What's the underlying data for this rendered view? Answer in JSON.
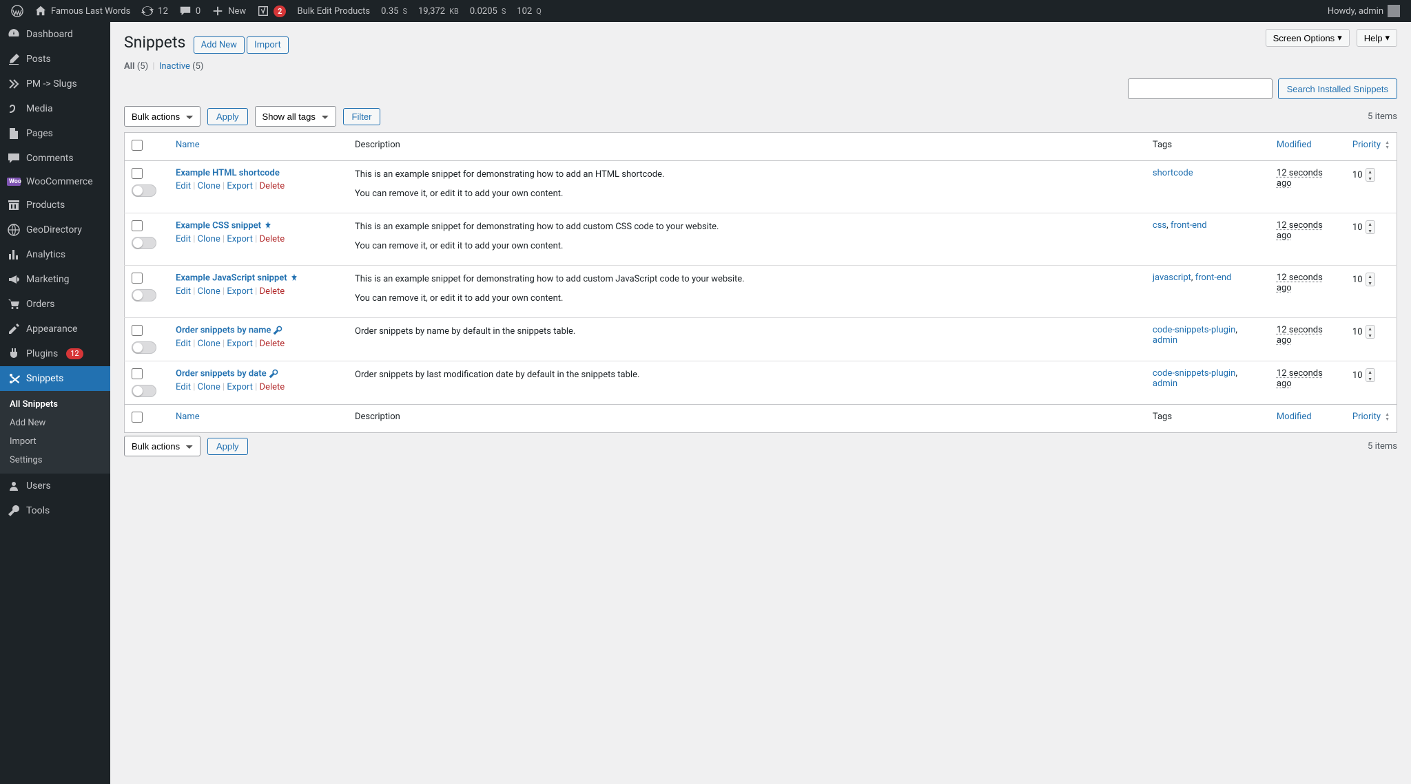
{
  "adminbar": {
    "site_name": "Famous Last Words",
    "updates": "12",
    "comments": "0",
    "new_label": "New",
    "yoast_count": "2",
    "bulk_edit": "Bulk Edit Products",
    "qm_time": "0.35",
    "qm_time_unit": "S",
    "qm_mem": "19,372",
    "qm_mem_unit": "KB",
    "qm_dbtime": "0.0205",
    "qm_dbtime_unit": "S",
    "qm_queries": "102",
    "qm_queries_unit": "Q",
    "howdy": "Howdy, admin"
  },
  "sidebar": {
    "dashboard": "Dashboard",
    "posts": "Posts",
    "pm_slugs": "PM -> Slugs",
    "media": "Media",
    "pages": "Pages",
    "comments": "Comments",
    "woocommerce": "WooCommerce",
    "products": "Products",
    "geodirectory": "GeoDirectory",
    "analytics": "Analytics",
    "marketing": "Marketing",
    "orders": "Orders",
    "appearance": "Appearance",
    "plugins": "Plugins",
    "plugins_count": "12",
    "snippets": "Snippets",
    "users": "Users",
    "tools": "Tools",
    "submenu": {
      "all": "All Snippets",
      "add": "Add New",
      "import": "Import",
      "settings": "Settings"
    }
  },
  "header": {
    "screen_options": "Screen Options",
    "help": "Help",
    "title": "Snippets",
    "add_new": "Add New",
    "import": "Import"
  },
  "filters": {
    "all_label": "All",
    "all_count": "(5)",
    "inactive_label": "Inactive",
    "inactive_count": "(5)",
    "search_button": "Search Installed Snippets",
    "bulk_actions": "Bulk actions",
    "apply": "Apply",
    "show_tags": "Show all tags",
    "filter": "Filter",
    "items_count": "5 items"
  },
  "columns": {
    "name": "Name",
    "description": "Description",
    "tags": "Tags",
    "modified": "Modified",
    "priority": "Priority"
  },
  "row_actions": {
    "edit": "Edit",
    "clone": "Clone",
    "export": "Export",
    "delete": "Delete"
  },
  "rows": [
    {
      "title": "Example HTML shortcode",
      "desc1": "This is an example snippet for demonstrating how to add an HTML shortcode.",
      "desc2": "You can remove it, or edit it to add your own content.",
      "tags": [
        {
          "t": "shortcode",
          "sep": ""
        }
      ],
      "modified": "12 seconds ago",
      "priority": "10",
      "icon": ""
    },
    {
      "title": "Example CSS snippet",
      "desc1": "This is an example snippet for demonstrating how to add custom CSS code to your website.",
      "desc2": "You can remove it, or edit it to add your own content.",
      "tags": [
        {
          "t": "css",
          "sep": ", "
        },
        {
          "t": "front-end",
          "sep": ""
        }
      ],
      "modified": "12 seconds ago",
      "priority": "10",
      "icon": "pin"
    },
    {
      "title": "Example JavaScript snippet",
      "desc1": "This is an example snippet for demonstrating how to add custom JavaScript code to your website.",
      "desc2": "You can remove it, or edit it to add your own content.",
      "tags": [
        {
          "t": "javascript",
          "sep": ", "
        },
        {
          "t": "front-end",
          "sep": ""
        }
      ],
      "modified": "12 seconds ago",
      "priority": "10",
      "icon": "pin"
    },
    {
      "title": "Order snippets by name",
      "desc1": "Order snippets by name by default in the snippets table.",
      "desc2": "",
      "tags": [
        {
          "t": "code-snippets-plugin",
          "sep": ", "
        },
        {
          "t": "admin",
          "sep": ""
        }
      ],
      "modified": "12 seconds ago",
      "priority": "10",
      "icon": "wrench"
    },
    {
      "title": "Order snippets by date",
      "desc1": "Order snippets by last modification date by default in the snippets table.",
      "desc2": "",
      "tags": [
        {
          "t": "code-snippets-plugin",
          "sep": ", "
        },
        {
          "t": "admin",
          "sep": ""
        }
      ],
      "modified": "12 seconds ago",
      "priority": "10",
      "icon": "wrench"
    }
  ]
}
